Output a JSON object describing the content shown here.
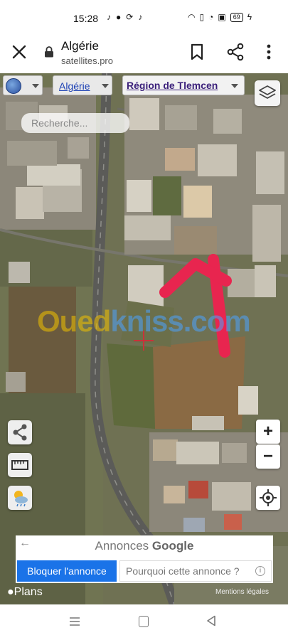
{
  "status_bar": {
    "time": "15:28",
    "battery": "69"
  },
  "browser": {
    "title": "Algérie",
    "url": "satellites.pro"
  },
  "map": {
    "country_select": "Algérie",
    "region_select": "Région de Tlemcen",
    "search_placeholder": "Recherche...",
    "watermark_part1": "Oued",
    "watermark_part2": "kniss",
    "watermark_part3": ".com",
    "zoom_in": "+",
    "zoom_out": "−",
    "plans_label": "Plans",
    "legal_label": "Mentions légales"
  },
  "ad": {
    "title_prefix": "Annonces",
    "title_brand": "Google",
    "block_button": "Bloquer l'annonce",
    "why_button": "Pourquoi cette annonce ?",
    "info_symbol": "i"
  },
  "colors": {
    "arrow": "#e8254f",
    "ad_button": "#1a73e8",
    "link": "#1a3fb4"
  }
}
